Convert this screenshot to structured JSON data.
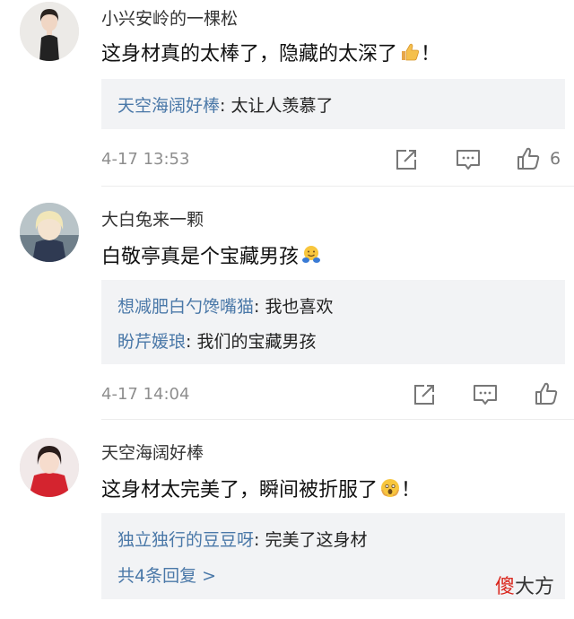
{
  "comments": [
    {
      "username": "小兴安岭的一棵松",
      "content": "这身材真的太棒了，隐藏的太深了",
      "emoji": "thumbs-up-icon",
      "trailing": "！",
      "replies": [
        {
          "user": "天空海阔好棒",
          "text": ": 太让人羡慕了"
        }
      ],
      "time": "4-17 13:53",
      "likes": "6"
    },
    {
      "username": "大白兔来一颗",
      "content": "白敬亭真是个宝藏男孩",
      "emoji": "hug-face-icon",
      "trailing": "",
      "replies": [
        {
          "user": "想减肥白勺馋嘴猫",
          "text": ": 我也喜欢"
        },
        {
          "user": "盼芹媛琅",
          "text": ": 我们的宝藏男孩"
        }
      ],
      "time": "4-17 14:04",
      "likes": ""
    },
    {
      "username": "天空海阔好棒",
      "content": "这身材太完美了，瞬间被折服了",
      "emoji": "astonished-face-icon",
      "trailing": "！",
      "replies": [
        {
          "user": "独立独行的豆豆呀",
          "text": ": 完美了这身材"
        }
      ],
      "more_replies": "共4条回复 >"
    }
  ],
  "watermark": {
    "highlight": "傻",
    "rest": "大方"
  },
  "colors": {
    "link": "#4a78a8",
    "reply_bg": "#f2f3f5",
    "meta": "#8e8e8e"
  }
}
